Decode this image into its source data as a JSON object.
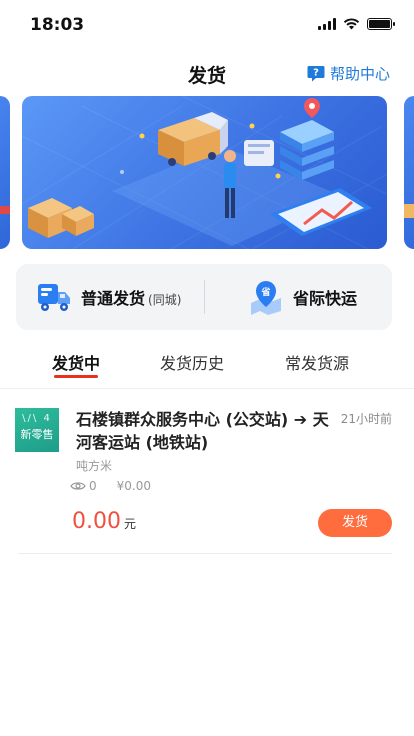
{
  "status_bar": {
    "time": "18:03",
    "signal_icon": "cellular-signal-icon",
    "wifi_icon": "wifi-icon",
    "battery_icon": "battery-icon"
  },
  "nav": {
    "title": "发货",
    "help_label": "帮助中心",
    "help_icon": "question-chat-icon"
  },
  "banner": {
    "image": "logistics-illustration",
    "bg_color": "#3d73e3"
  },
  "ship_options": {
    "normal": {
      "label": "普通发货",
      "sub": "(同城)",
      "icon": "truck-icon"
    },
    "province": {
      "label": "省际快运",
      "icon": "province-map-pin-icon",
      "icon_text": "省"
    }
  },
  "tabs": [
    {
      "label": "发货中",
      "active": true
    },
    {
      "label": "发货历史",
      "active": false
    },
    {
      "label": "常发货源",
      "active": false
    }
  ],
  "items": [
    {
      "thumb_top": "\\/\\ 4",
      "thumb_text": "新零售",
      "route": "石楼镇群众服务中心 (公交站) ➔ 天河客运站 (地铁站)",
      "time_ago": "21小时前",
      "unit": "吨方米",
      "views": "0",
      "fee": "¥0.00",
      "price": "0.00",
      "price_unit": "元",
      "action_label": "发货"
    }
  ],
  "colors": {
    "accent_blue": "#1f7ad9",
    "accent_red": "#e8321d",
    "button_orange": "#ff6c3e",
    "price_red": "#f0513f"
  }
}
